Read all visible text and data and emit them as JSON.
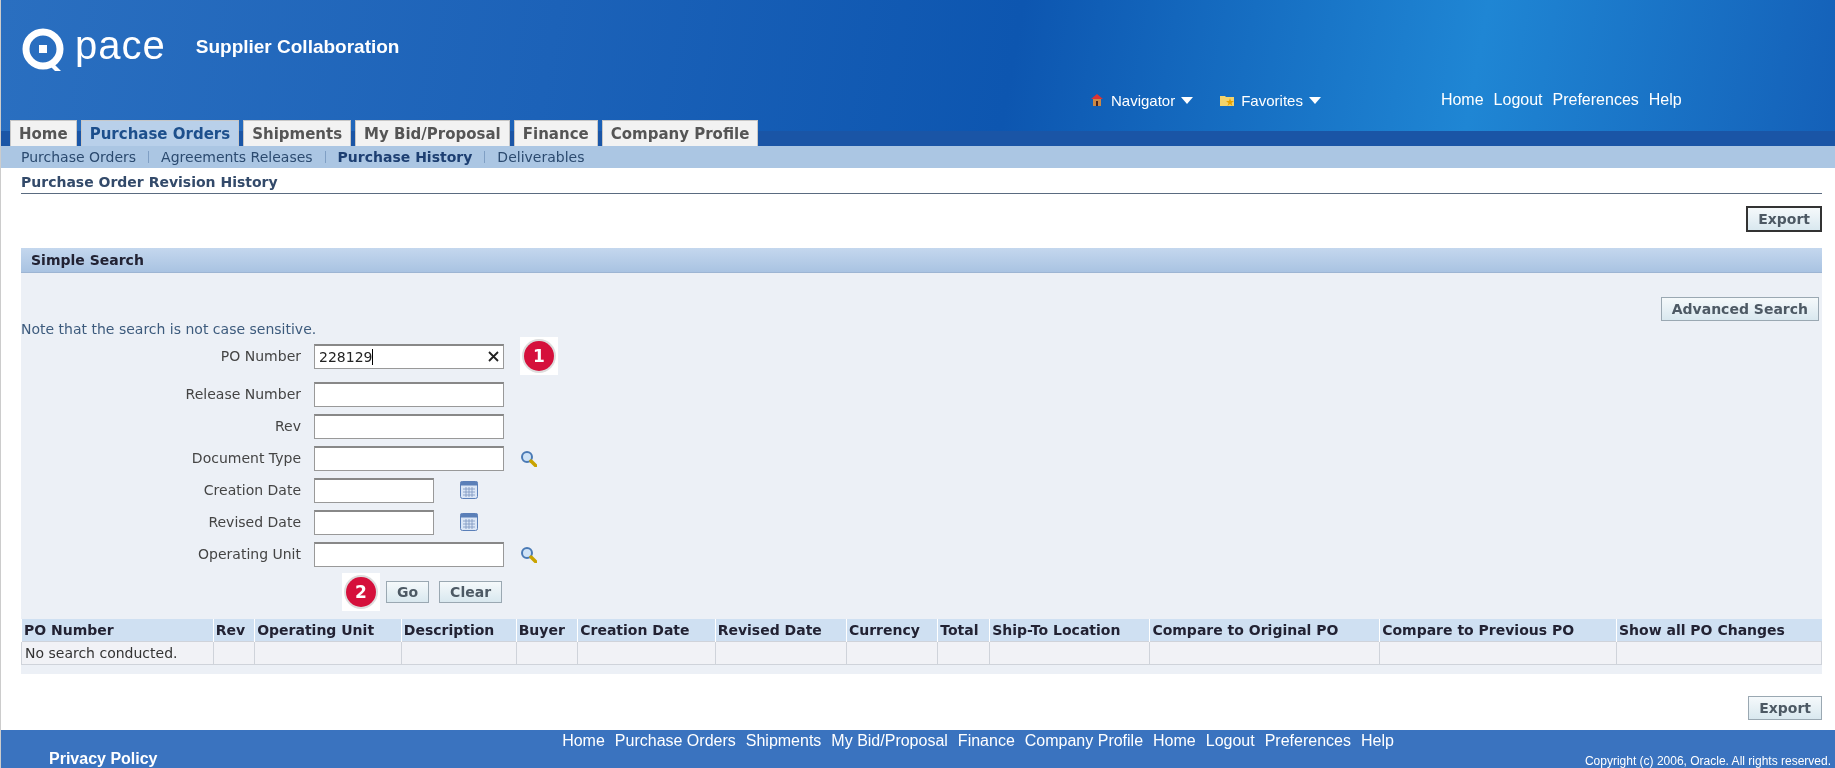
{
  "header": {
    "logo_text": "pace",
    "app_title": "Supplier Collaboration",
    "menus": [
      {
        "label": "Navigator"
      },
      {
        "label": "Favorites"
      }
    ],
    "global_links": [
      "Home",
      "Logout",
      "Preferences",
      "Help"
    ]
  },
  "tabs": [
    {
      "label": "Home",
      "selected": false
    },
    {
      "label": "Purchase Orders",
      "selected": true
    },
    {
      "label": "Shipments",
      "selected": false
    },
    {
      "label": "My Bid/Proposal",
      "selected": false
    },
    {
      "label": "Finance",
      "selected": false
    },
    {
      "label": "Company Profile",
      "selected": false
    }
  ],
  "subtabs": [
    {
      "label": "Purchase Orders",
      "selected": false
    },
    {
      "label": "Agreements Releases",
      "selected": false
    },
    {
      "label": "Purchase History",
      "selected": true
    },
    {
      "label": "Deliverables",
      "selected": false
    }
  ],
  "page_title": "Purchase Order Revision History",
  "top_button": "Export",
  "search": {
    "title": "Simple Search",
    "note": "Note that the search is not case sensitive.",
    "advanced_button": "Advanced Search",
    "fields": [
      {
        "label": "PO Number",
        "kind": "text",
        "value": "228129",
        "clearable": true,
        "marker": "1"
      },
      {
        "label": "Release Number",
        "kind": "text"
      },
      {
        "label": "Rev",
        "kind": "text"
      },
      {
        "label": "Document Type",
        "kind": "lov"
      },
      {
        "label": "Creation Date",
        "kind": "date"
      },
      {
        "label": "Revised Date",
        "kind": "date"
      },
      {
        "label": "Operating Unit",
        "kind": "lov"
      }
    ],
    "buttons_marker": "2",
    "buttons": [
      "Go",
      "Clear"
    ]
  },
  "table": {
    "columns": [
      "PO Number",
      "Rev",
      "Operating Unit",
      "Description",
      "Buyer",
      "Creation Date",
      "Revised Date",
      "Currency",
      "Total",
      "Ship-To Location",
      "Compare to Original PO",
      "Compare to Previous PO",
      "Show all PO Changes"
    ],
    "empty_message": "No search conducted."
  },
  "bottom_button": "Export",
  "footer": {
    "links": [
      "Home",
      "Purchase Orders",
      "Shipments",
      "My Bid/Proposal",
      "Finance",
      "Company Profile",
      "Home",
      "Logout",
      "Preferences",
      "Help"
    ],
    "privacy": "Privacy Policy",
    "copyright": "Copyright (c) 2006, Oracle. All rights reserved."
  }
}
